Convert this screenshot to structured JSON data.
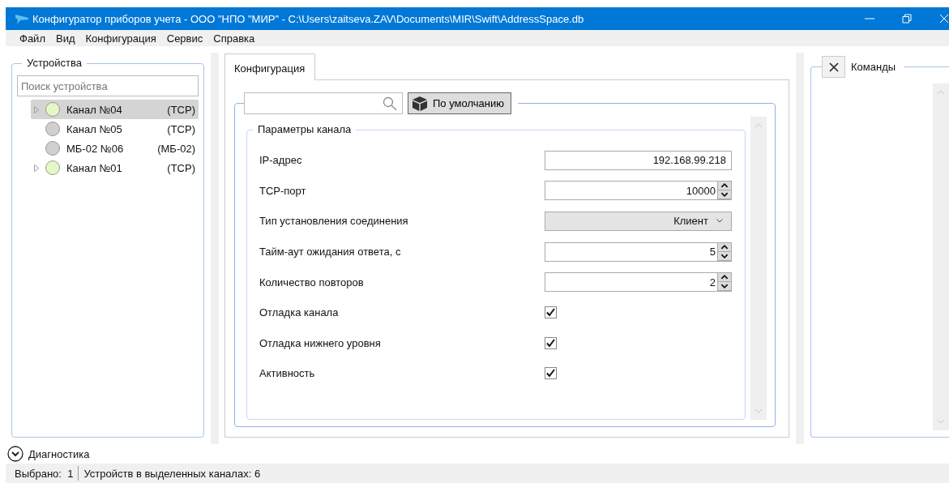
{
  "window": {
    "title": "Конфигуратор приборов учета - ООО \"НПО \"МИР\" - C:\\Users\\zaitseva.ZAV\\Documents\\MIR\\Swift\\AddressSpace.db"
  },
  "menu": [
    "Файл",
    "Вид",
    "Конфигурация",
    "Сервис",
    "Справка"
  ],
  "devices": {
    "title": "Устройства",
    "search_placeholder": "Поиск устройства",
    "items": [
      {
        "name": "Канал №04",
        "type": "(TCP)",
        "color": "#e4f8c4",
        "expandable": true,
        "selected": true
      },
      {
        "name": "Канал №05",
        "type": "(TCP)",
        "color": "#d0d0d0",
        "expandable": false,
        "selected": false
      },
      {
        "name": "МБ-02 №06",
        "type": "(МБ-02)",
        "color": "#d0d0d0",
        "expandable": false,
        "selected": false
      },
      {
        "name": "Канал №01",
        "type": "(TCP)",
        "color": "#e4f8c4",
        "expandable": true,
        "selected": false
      }
    ]
  },
  "tabs": [
    {
      "label": "Конфигурация",
      "selected": true
    }
  ],
  "toolbar": {
    "default_button": "По умолчанию"
  },
  "params": {
    "title": "Параметры канала",
    "rows": [
      {
        "kind": "text",
        "label": "IP-адрес",
        "value": "192.168.99.218"
      },
      {
        "kind": "spin",
        "label": "TCP-порт",
        "value": "10000"
      },
      {
        "kind": "combo",
        "label": "Тип установления соединения",
        "value": "Клиент"
      },
      {
        "kind": "spin",
        "label": "Тайм-аут ожидания ответа, с",
        "value": "5"
      },
      {
        "kind": "spin",
        "label": "Количество повторов",
        "value": "2"
      },
      {
        "kind": "check",
        "label": "Отладка канала",
        "checked": true
      },
      {
        "kind": "check",
        "label": "Отладка нижнего уровня",
        "checked": true
      },
      {
        "kind": "check",
        "label": "Активность",
        "checked": true
      }
    ]
  },
  "commands": {
    "title": "Команды"
  },
  "diagnostics": {
    "label": "Диагностика",
    "expanded": false
  },
  "status_bar": {
    "selected": "Выбрано:  1",
    "devices": "Устройств в выделенных каналах: 6"
  }
}
